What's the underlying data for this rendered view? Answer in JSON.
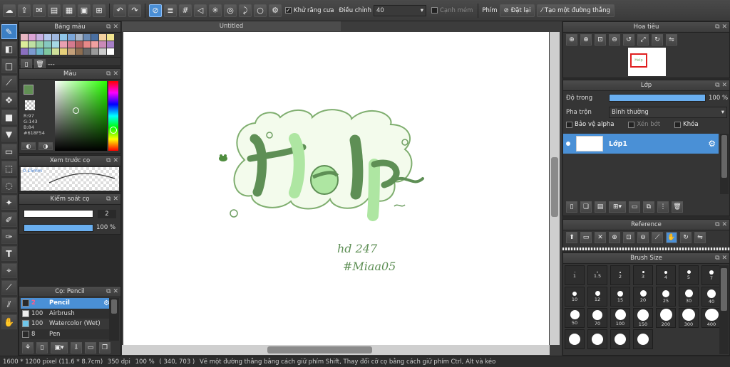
{
  "toolbar": {
    "antialias_label": "Khử răng cưa",
    "correction_label": "Điều chỉnh",
    "correction_value": "40",
    "edge_label": "Cạnh mém",
    "key_label": "Phím",
    "reset_label": "Đặt lại",
    "make_line_label": "Tạo một đường thẳng"
  },
  "palette_panel": {
    "title": "Bảng màu",
    "dashes": "---",
    "swatches": [
      "#e9b7c3",
      "#dba4d6",
      "#c7b0e3",
      "#b5c9ef",
      "#9fb8e0",
      "#8fc5e8",
      "#7ba6d9",
      "#a8b6c8",
      "#6a8bb5",
      "#4a6fa1",
      "#f4d1a0",
      "#f2e58f",
      "#dcec9a",
      "#bfe0a3",
      "#98d3a8",
      "#86c8c0",
      "#a6d8e5",
      "#e8a0b0",
      "#d47a8e",
      "#b56060",
      "#e88888",
      "#f0a0a0",
      "#c98ab8",
      "#a77fc7",
      "#8a6fbf",
      "#7c9ad0",
      "#6db7c9",
      "#7fc9a0",
      "#cfe09a",
      "#e6cf7a",
      "#c4a07a",
      "#8c6d50",
      "#666666",
      "#9a9a9a",
      "#cccccc",
      "#ffffff"
    ]
  },
  "color_panel": {
    "title": "Màu",
    "r": "R:97",
    "g": "G:143",
    "b": "B:84",
    "hex": "#618F54",
    "fg": "#618f54",
    "bg": "#101010"
  },
  "brush_preview": {
    "title": "Xem trước cọ",
    "size_label": "0.15mm"
  },
  "brush_control": {
    "title": "Kiểm soát cọ",
    "size": "2",
    "opacity": "100",
    "unit": "%",
    "opacity_fraction": 1.0
  },
  "brush_list": {
    "title": "Cọ: Pencil",
    "items": [
      {
        "size": "2",
        "name": "Pencil",
        "color": "#2a2a2a",
        "selected": true
      },
      {
        "size": "100",
        "name": "Airbrush",
        "color": "#eeeeee",
        "selected": false
      },
      {
        "size": "100",
        "name": "Watercolor (Wet)",
        "color": "#6fc6ea",
        "selected": false
      },
      {
        "size": "8",
        "name": "Pen",
        "color": "#2a2a2a",
        "selected": false
      }
    ]
  },
  "document": {
    "tab_title": "Untitled"
  },
  "artwork": {
    "word": "Help",
    "line1": "hd 247",
    "line2": "#Miaa05"
  },
  "navigator": {
    "title": "Hoa tiêu",
    "thumb_text": "Help"
  },
  "layers": {
    "title": "Lớp",
    "opacity_label": "Độ trong",
    "opacity_value": "100",
    "opacity_unit": "%",
    "opacity_fraction": 1.0,
    "blend_label": "Pha trộn",
    "blend_value": "Bình thường",
    "alpha_label": "Bảo vệ alpha",
    "clip_label": "Xén bớt",
    "lock_label": "Khóa",
    "items": [
      {
        "name": "Lớp1"
      }
    ]
  },
  "reference": {
    "title": "Reference"
  },
  "brush_size": {
    "title": "Brush Size",
    "sizes": [
      "1",
      "1.5",
      "2",
      "3",
      "4",
      "5",
      "7",
      "10",
      "12",
      "15",
      "20",
      "25",
      "30",
      "40",
      "50",
      "70",
      "100",
      "150",
      "200",
      "300",
      "400",
      "",
      "",
      "",
      ""
    ]
  },
  "status": {
    "pixel_size": "1600 * 1200 pixel",
    "physical": "(11.6 * 8.7cm)",
    "dpi": "350 dpi",
    "zoom": "100 %",
    "coords": "( 340, 703 )",
    "hint": "Vẽ một đường thẳng bằng cách giữ phím Shift, Thay đổi cỡ cọ bằng cách giữ phím Ctrl, Alt và kéo"
  }
}
